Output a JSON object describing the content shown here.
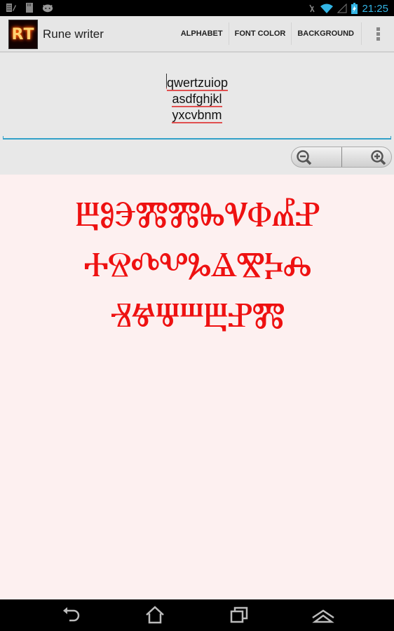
{
  "status_bar": {
    "left_icons": [
      "notes-icon",
      "sd-card-icon",
      "android-debug-icon"
    ],
    "right_icons": [
      "mute-icon",
      "wifi-icon",
      "signal-icon",
      "battery-charging-icon"
    ],
    "time": "21:25"
  },
  "action_bar": {
    "app_icon_text": "RT",
    "title": "Rune writer",
    "actions": [
      {
        "label": "ALPHABET"
      },
      {
        "label": "FONT COLOR"
      },
      {
        "label": "BACKGROUND"
      }
    ],
    "overflow_icon": "overflow-menu-icon"
  },
  "input": {
    "lines": [
      "qwertzuiop",
      "asdfghjkl",
      "yxcvbnm"
    ],
    "spellcheck_underline_color": "#e05050",
    "focus_color": "#33a1c9"
  },
  "zoom_controls": {
    "zoom_out_icon": "zoom-out-icon",
    "zoom_in_icon": "zoom-in-icon"
  },
  "rune_output": {
    "font_color": "#ee1111",
    "background_color": "#fdf0f0",
    "lines": [
      "ⰁⰑⰅⰏⰏⰈⰜⰗⰌⰐ",
      "ⰀⰔⰄⰂⰃⰡⰊⰍⰎ",
      "ⰠⰝⰛⰞⰁⰐⰏ"
    ]
  },
  "nav_bar": {
    "buttons": [
      "back",
      "home",
      "recent-apps",
      "menu"
    ]
  }
}
